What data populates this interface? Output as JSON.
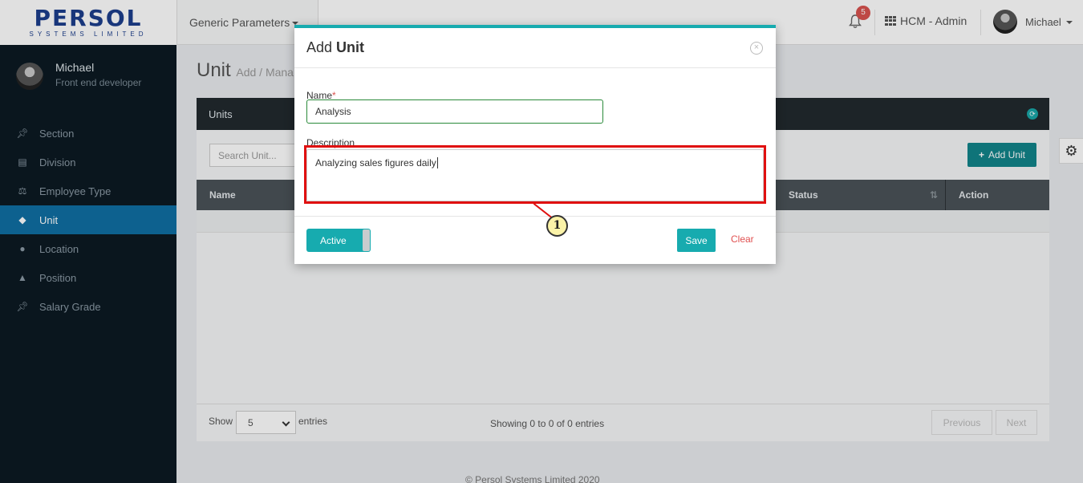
{
  "brand": {
    "logo_text": "PERSOL",
    "logo_sub": "SYSTEMS LIMITED"
  },
  "sidebar": {
    "profile_name": "Michael",
    "profile_role": "Front end developer",
    "items": [
      {
        "label": "Section",
        "icon": "pin-icon"
      },
      {
        "label": "Division",
        "icon": "document-icon"
      },
      {
        "label": "Employee Type",
        "icon": "scale-icon"
      },
      {
        "label": "Unit",
        "icon": "tag-icon",
        "active": true
      },
      {
        "label": "Location",
        "icon": "map-pin-icon"
      },
      {
        "label": "Position",
        "icon": "graduation-cap-icon"
      },
      {
        "label": "Salary Grade",
        "icon": "pin-icon"
      }
    ]
  },
  "topbar": {
    "module_tab": "Generic Parameters",
    "notification_count": "5",
    "app_name": "HCM - Admin",
    "user_name": "Michael"
  },
  "page": {
    "title": "Unit",
    "subtitle": "Add / Mana"
  },
  "card": {
    "header": "Units",
    "search_placeholder": "Search Unit...",
    "add_button": "Add Unit",
    "columns": [
      "Name",
      "Status",
      "Action"
    ],
    "show_label": "Show",
    "page_size": "5",
    "entries_label": "entries",
    "showing_text": "Showing 0 to 0 of 0 entries",
    "prev_label": "Previous",
    "next_label": "Next"
  },
  "footer": {
    "text": "© Persol Systems Limited 2020"
  },
  "modal": {
    "title_prefix": "Add",
    "title_bold": "Unit",
    "name_label": "Name",
    "required_mark": "*",
    "name_value": "Analysis",
    "description_label": "Description",
    "description_value": "Analyzing sales figures daily",
    "toggle_label": "Active",
    "save_label": "Save",
    "clear_label": "Clear"
  },
  "annotation": {
    "callout_number": "1"
  },
  "colors": {
    "accent": "#17abaf",
    "sidebar_bg": "#0c1a23",
    "active_nav": "#0f6fa3",
    "highlight": "#e01010"
  }
}
